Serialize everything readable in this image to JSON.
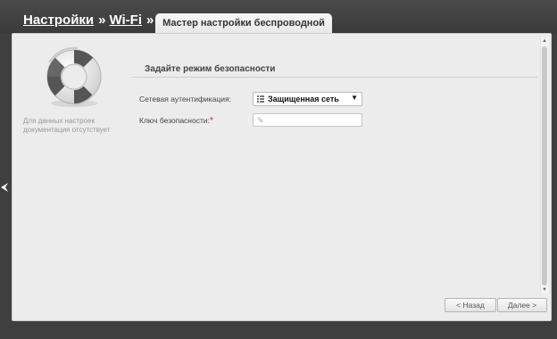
{
  "breadcrumb": {
    "settings": "Настройки",
    "sep1": "»",
    "wifi": "Wi-Fi",
    "sep2": "»"
  },
  "tab": {
    "label": "Мастер настройки беспроводной сети"
  },
  "help": {
    "text": "Для данных настроек документация отсутствует",
    "icon": "lifebuoy-icon"
  },
  "section": {
    "title": "Задайте режим безопасности"
  },
  "auth": {
    "label": "Сетевая аутентификация:",
    "value": "Защищенная сеть",
    "arrow": "▼"
  },
  "key": {
    "label": "Ключ безопасности:",
    "required_mark": "*",
    "value": ""
  },
  "buttons": {
    "back": "< Назад",
    "next": "Далее >"
  },
  "colors": {
    "background": "#3f3f3f",
    "panel": "#ececec",
    "required": "#d22222"
  }
}
